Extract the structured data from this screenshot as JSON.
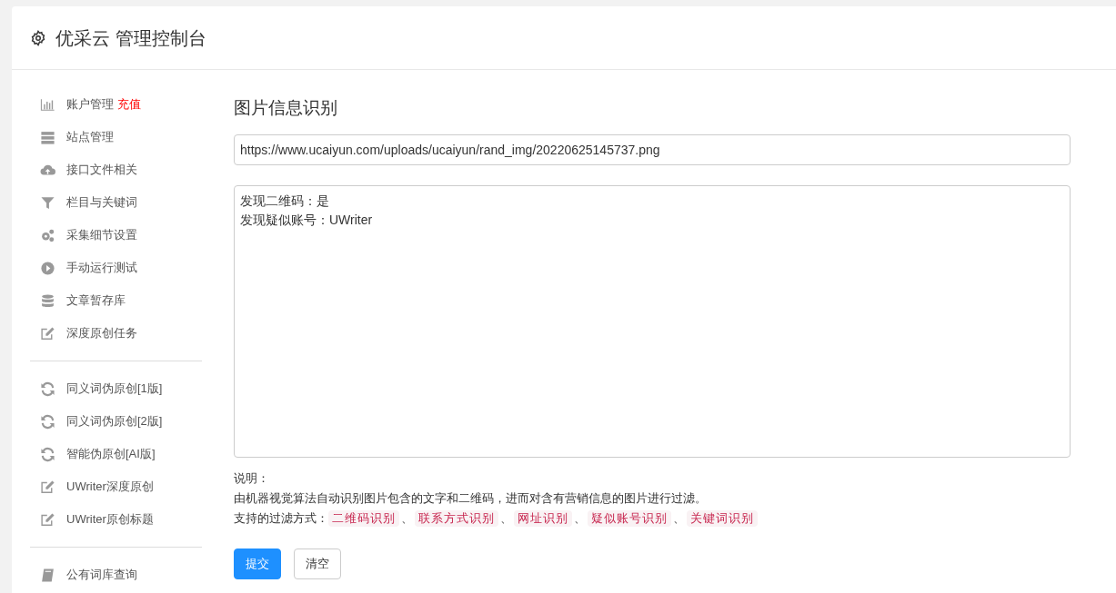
{
  "header": {
    "title": "优采云 管理控制台"
  },
  "sidebar": {
    "groups": [
      {
        "items": [
          {
            "label": "账户管理",
            "kind": "chart",
            "badge": "充值"
          },
          {
            "label": "站点管理",
            "kind": "server"
          },
          {
            "label": "接口文件相关",
            "kind": "cloud"
          },
          {
            "label": "栏目与关键词",
            "kind": "filter"
          },
          {
            "label": "采集细节设置",
            "kind": "gears"
          },
          {
            "label": "手动运行测试",
            "kind": "play"
          },
          {
            "label": "文章暂存库",
            "kind": "database"
          },
          {
            "label": "深度原创任务",
            "kind": "edit"
          }
        ]
      },
      {
        "items": [
          {
            "label": "同义词伪原创[1版]",
            "kind": "refresh"
          },
          {
            "label": "同义词伪原创[2版]",
            "kind": "refresh"
          },
          {
            "label": "智能伪原创[AI版]",
            "kind": "refresh"
          },
          {
            "label": "UWriter深度原创",
            "kind": "edit"
          },
          {
            "label": "UWriter原创标题",
            "kind": "edit"
          }
        ]
      },
      {
        "items": [
          {
            "label": "公有词库查询",
            "kind": "book"
          }
        ]
      }
    ]
  },
  "main": {
    "title": "图片信息识别",
    "url_field": {
      "value": "https://www.ucaiyun.com/uploads/ucaiyun/rand_img/20220625145737.png"
    },
    "result_box": {
      "lines": [
        "发现二维码：是",
        "发现疑似账号：UWriter"
      ]
    },
    "notes": {
      "heading": "说明：",
      "description": "由机器视觉算法自动识别图片包含的文字和二维码，进而对含有营销信息的图片进行过滤。",
      "methods_label": "支持的过滤方式：",
      "methods": [
        {
          "label": "二维码识别",
          "separator": "、"
        },
        {
          "label": "联系方式识别",
          "separator": "、"
        },
        {
          "label": "网址识别",
          "separator": "、"
        },
        {
          "label": "疑似账号识别",
          "separator": "、"
        },
        {
          "label": "关键词识别"
        }
      ]
    },
    "buttons": [
      {
        "label": "提交",
        "kind": "primary"
      },
      {
        "label": "清空",
        "kind": "default"
      }
    ]
  }
}
